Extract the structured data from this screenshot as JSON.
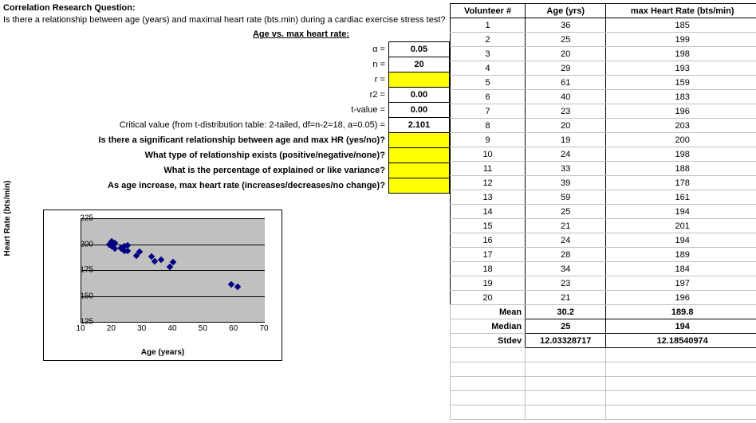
{
  "header": {
    "title": "Correlation Research Question:",
    "question": "Is there a relationship between age (years) and maximal heart rate (bts.min) during a cardiac exercise stress test?",
    "subtitle": "Age vs. max heart rate:"
  },
  "params": [
    {
      "label": "α =",
      "value": "0.05",
      "bold_label": false,
      "bold_val": true,
      "yellow": false
    },
    {
      "label": "n =",
      "value": "20",
      "bold_label": false,
      "bold_val": true,
      "yellow": false
    },
    {
      "label": "r =",
      "value": "",
      "bold_label": false,
      "bold_val": true,
      "yellow": true
    },
    {
      "label": "r2 =",
      "value": "0.00",
      "bold_label": false,
      "bold_val": true,
      "yellow": false
    },
    {
      "label": "t-value =",
      "value": "0.00",
      "bold_label": false,
      "bold_val": true,
      "yellow": false
    },
    {
      "label": "Critical value (from t-distribution table: 2-tailed, df=n-2=18, a=0.05) =",
      "value": "2.101",
      "bold_label": false,
      "bold_val": true,
      "yellow": false
    },
    {
      "label": "Is there a significant relationship between age and max HR (yes/no)?",
      "value": "",
      "bold_label": true,
      "bold_val": false,
      "yellow": true
    },
    {
      "label": "What type of relationship exists (positive/negative/none)?",
      "value": "",
      "bold_label": true,
      "bold_val": false,
      "yellow": true
    },
    {
      "label": "What is the percentage of explained or like variance?",
      "value": "",
      "bold_label": true,
      "bold_val": false,
      "yellow": true
    },
    {
      "label": "As age increase, max heart rate (increases/decreases/no change)?",
      "value": "",
      "bold_label": true,
      "bold_val": false,
      "yellow": true
    }
  ],
  "table": {
    "headers": [
      "Volunteer #",
      "Age (yrs)",
      "max Heart Rate (bts/min)"
    ],
    "rows": [
      [
        1,
        36,
        185
      ],
      [
        2,
        25,
        199
      ],
      [
        3,
        20,
        198
      ],
      [
        4,
        29,
        193
      ],
      [
        5,
        61,
        159
      ],
      [
        6,
        40,
        183
      ],
      [
        7,
        23,
        196
      ],
      [
        8,
        20,
        203
      ],
      [
        9,
        19,
        200
      ],
      [
        10,
        24,
        198
      ],
      [
        11,
        33,
        188
      ],
      [
        12,
        39,
        178
      ],
      [
        13,
        59,
        161
      ],
      [
        14,
        25,
        194
      ],
      [
        15,
        21,
        201
      ],
      [
        16,
        24,
        194
      ],
      [
        17,
        28,
        189
      ],
      [
        18,
        34,
        184
      ],
      [
        19,
        23,
        197
      ],
      [
        20,
        21,
        196
      ]
    ],
    "stats": [
      {
        "label": "Mean",
        "age": "30.2",
        "hr": "189.8"
      },
      {
        "label": "Median",
        "age": "25",
        "hr": "194"
      },
      {
        "label": "Stdev",
        "age": "12.03328717",
        "hr": "12.18540974"
      }
    ]
  },
  "chart_data": {
    "type": "scatter",
    "title": "",
    "xlabel": "Age (years)",
    "ylabel": "Heart Rate (bts/min)",
    "xlim": [
      10,
      70
    ],
    "ylim": [
      125,
      225
    ],
    "xticks": [
      10,
      20,
      30,
      40,
      50,
      60,
      70
    ],
    "yticks": [
      125,
      150,
      175,
      200,
      225
    ],
    "series": [
      {
        "name": "data",
        "x": [
          36,
          25,
          20,
          29,
          61,
          40,
          23,
          20,
          19,
          24,
          33,
          39,
          59,
          25,
          21,
          24,
          28,
          34,
          23,
          21
        ],
        "y": [
          185,
          199,
          198,
          193,
          159,
          183,
          196,
          203,
          200,
          198,
          188,
          178,
          161,
          194,
          201,
          194,
          189,
          184,
          197,
          196
        ]
      }
    ]
  }
}
